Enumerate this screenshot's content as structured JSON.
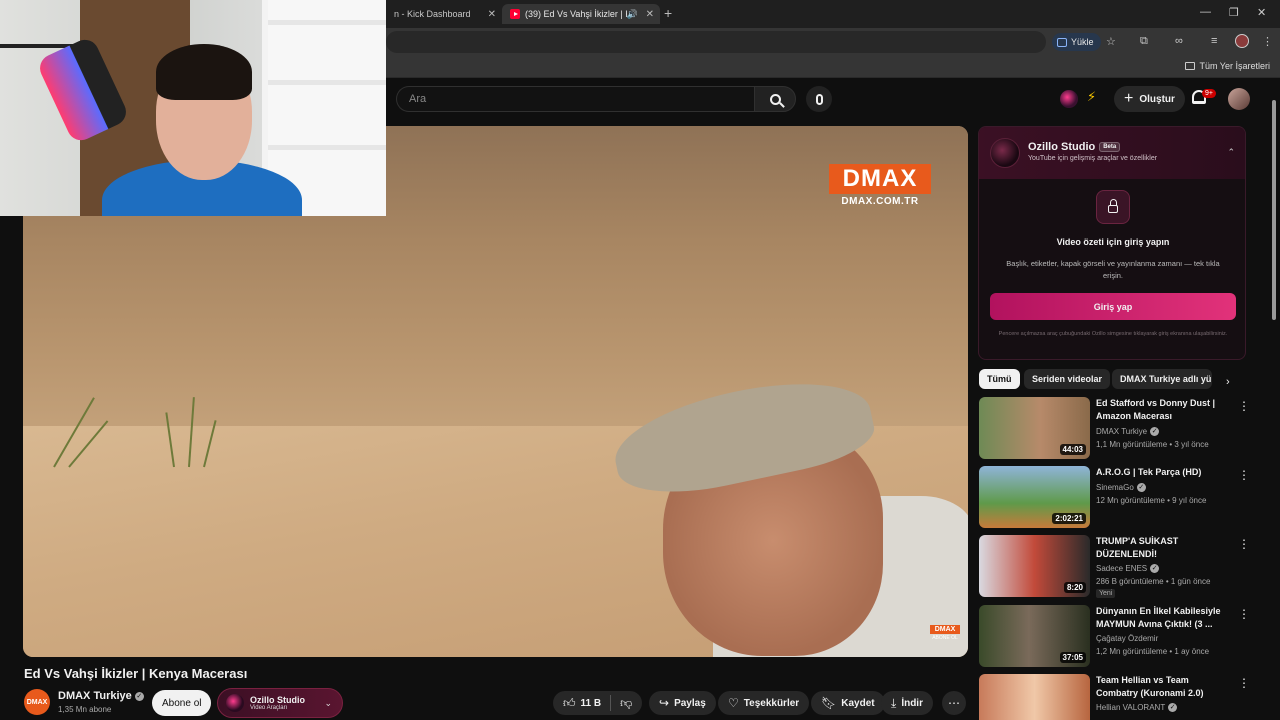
{
  "browser": {
    "tabs": [
      {
        "label": "n - Kick Dashboard"
      },
      {
        "label": "(39) Ed Vs Vahşi İkizler | Ken"
      }
    ],
    "yukle_label": "Yükle",
    "bookmarks_all": "Tüm Yer İşaretleri"
  },
  "masthead": {
    "search_placeholder": "Ara",
    "create_label": "Oluştur",
    "notifications_badge": "9+"
  },
  "player": {
    "watermark": "DMAX",
    "watermark_url": "DMAX.COM.TR",
    "corner_logo": "DMAX",
    "corner_sub": "ABONE OL"
  },
  "video": {
    "title": "Ed Vs Vahşi İkizler | Kenya Macerası",
    "channel": "DMAX Turkiye",
    "channel_avatar_text": "DMAX",
    "subscribers": "1,35 Mn abone",
    "subscribe_label": "Abone ol",
    "ozillo_title": "Ozillo Studio",
    "ozillo_sub": "Video Araçları",
    "likes": "11 B",
    "share_label": "Paylaş",
    "thanks_label": "Teşekkürler",
    "save_label": "Kaydet",
    "download_label": "İndir"
  },
  "ozillo_panel": {
    "title": "Ozillo Studio",
    "beta": "Beta",
    "subtitle": "YouTube için gelişmiş araçlar ve özellikler",
    "heading": "Video özeti için giriş yapın",
    "description": "Başlık, etiketler, kapak görseli ve yayınlanma zamanı — tek tıkla erişin.",
    "login_label": "Giriş yap",
    "footnote": "Pencere açılmazsa araç çubuğundaki Ozillo simgesine tıklayarak giriş ekranına ulaşabilirsiniz."
  },
  "chips": [
    "Tümü",
    "Seriden videolar",
    "DMAX Turkiye adlı yü"
  ],
  "recommendations": [
    {
      "title": "Ed Stafford vs Donny Dust | Amazon Macerası",
      "channel": "DMAX Turkiye",
      "meta": "1,1 Mn görüntüleme • 3 yıl önce",
      "duration": "44:03",
      "badge": ""
    },
    {
      "title": "A.R.O.G | Tek Parça (HD)",
      "channel": "SinemaGo",
      "meta": "12 Mn görüntüleme • 9 yıl önce",
      "duration": "2:02:21",
      "badge": ""
    },
    {
      "title": "TRUMP'A SUİKAST DÜZENLENDİ!",
      "channel": "Sadece ENES",
      "meta": "286 B görüntüleme • 1 gün önce",
      "duration": "8:20",
      "badge": "Yeni"
    },
    {
      "title": "Dünyanın En İlkel Kabilesiyle MAYMUN Avına Çıktık! (3 ...",
      "channel": "Çağatay Özdemir",
      "meta": "1,2 Mn görüntüleme • 1 ay önce",
      "duration": "37:05",
      "badge": ""
    },
    {
      "title": "Team Hellian vs Team Combatry (Kuronami 2.0)",
      "channel": "Hellian VALORANT",
      "meta": "",
      "duration": "",
      "badge": ""
    }
  ],
  "colors": {
    "accent_pink": "#e2327a",
    "dmax_orange": "#e85a1c",
    "background": "#0f0f0f"
  }
}
